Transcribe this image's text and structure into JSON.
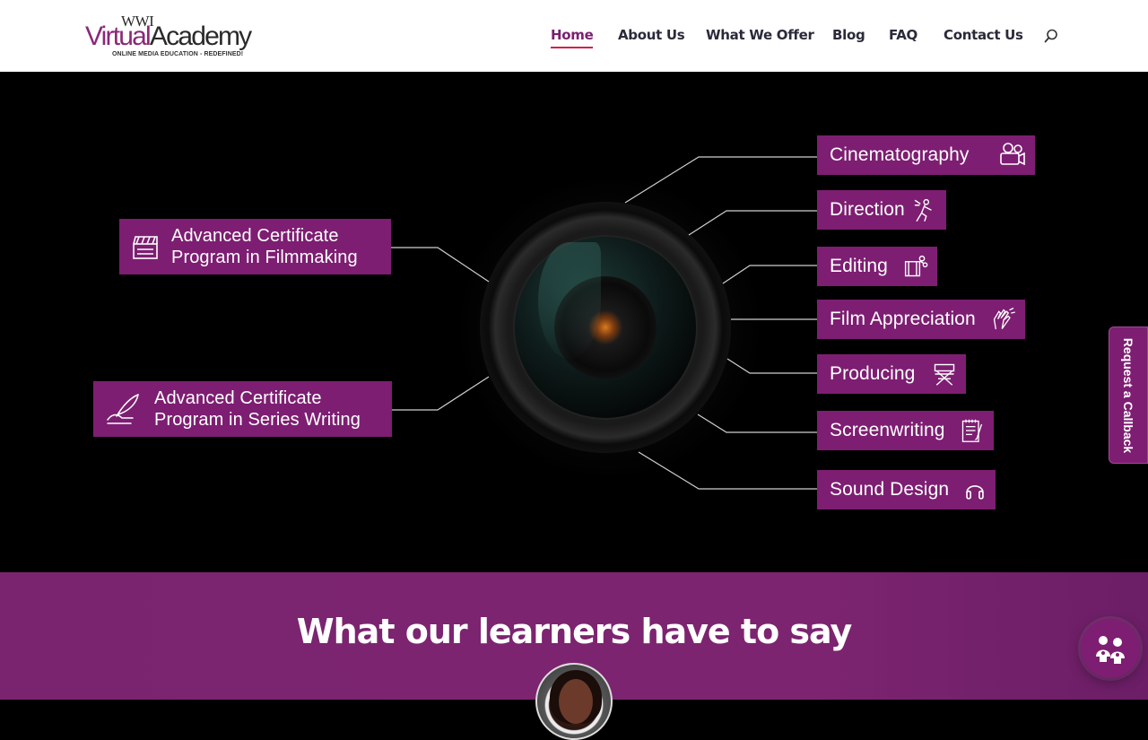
{
  "header": {
    "logo": {
      "top": "WWI",
      "virtual": "Virtual",
      "academy": "Academy",
      "tagline": "ONLINE MEDIA EDUCATION - REDEFINED!"
    },
    "nav": [
      {
        "label": "Home",
        "active": true
      },
      {
        "label": "About Us"
      },
      {
        "label": "What We Offer"
      },
      {
        "label": "Blog"
      },
      {
        "label": "FAQ"
      },
      {
        "label": "Contact Us"
      }
    ],
    "search_icon": "search-icon"
  },
  "hero": {
    "programs": [
      {
        "line1": "Advanced Certificate",
        "line2": "Program in Filmmaking",
        "icon": "clapperboard-icon"
      },
      {
        "line1": "Advanced Certificate",
        "line2": "Program in Series Writing",
        "icon": "quill-hand-icon"
      }
    ],
    "courses": [
      {
        "label": "Cinematography",
        "icon": "movie-camera-icon"
      },
      {
        "label": "Direction",
        "icon": "director-megaphone-icon"
      },
      {
        "label": "Editing",
        "icon": "film-edit-icon"
      },
      {
        "label": "Film Appreciation",
        "icon": "clapping-hands-icon"
      },
      {
        "label": "Producing",
        "icon": "director-chair-icon"
      },
      {
        "label": "Screenwriting",
        "icon": "script-icon"
      },
      {
        "label": "Sound Design",
        "icon": "headphones-icon"
      }
    ]
  },
  "callback": {
    "label": "Request a Callback"
  },
  "testimonials": {
    "heading": "What our learners have to say"
  },
  "colors": {
    "brand": "#7d1e72",
    "active_underline": "#d0204f",
    "nav_text": "#2a2a3a"
  }
}
